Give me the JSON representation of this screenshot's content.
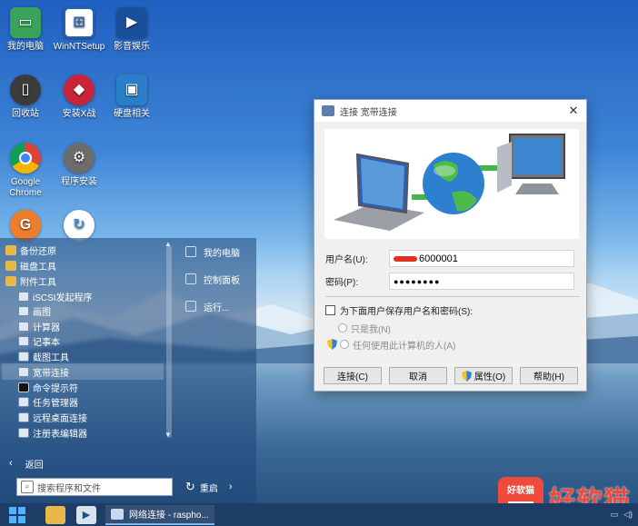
{
  "desktop": {
    "icons": [
      {
        "label": "我的电脑",
        "icon": "computer-icon",
        "color": "#3aa35a"
      },
      {
        "label": "WinNTSetup",
        "icon": "winntsetup-icon",
        "color": "#2a62b0"
      },
      {
        "label": "影音娱乐",
        "icon": "media-icon",
        "color": "#1a4f9a"
      },
      {
        "label": "回收站",
        "icon": "recycle-bin-icon",
        "color": "#3b3b3b"
      },
      {
        "label": "安装X战",
        "icon": "installer-icon",
        "color": "#c9243a"
      },
      {
        "label": "硬盘相关",
        "icon": "harddisk-icon",
        "color": "#2a7fc8"
      },
      {
        "label": "Google Chrome",
        "icon": "chrome-icon",
        "color": "#db4437"
      },
      {
        "label": "程序安装",
        "icon": "gear-icon",
        "color": "#6c6c6c"
      },
      {
        "label": "",
        "icon": "g-app-icon",
        "color": "#ef7d2a"
      },
      {
        "label": "",
        "icon": "refresh-app-icon",
        "color": "#ffffff"
      }
    ]
  },
  "start_menu": {
    "items": [
      {
        "label": "备份还原",
        "type": "folder"
      },
      {
        "label": "磁盘工具",
        "type": "folder"
      },
      {
        "label": "附件工具",
        "type": "folder"
      },
      {
        "label": "iSCSI发起程序",
        "type": "app"
      },
      {
        "label": "画图",
        "type": "app"
      },
      {
        "label": "计算器",
        "type": "app"
      },
      {
        "label": "记事本",
        "type": "app"
      },
      {
        "label": "截图工具",
        "type": "app"
      },
      {
        "label": "宽带连接",
        "type": "app"
      },
      {
        "label": "命令提示符",
        "type": "app"
      },
      {
        "label": "任务管理器",
        "type": "app"
      },
      {
        "label": "远程桌面连接",
        "type": "app"
      },
      {
        "label": "注册表编辑器",
        "type": "app"
      }
    ],
    "right_items": [
      {
        "label": "我的电脑"
      },
      {
        "label": "控制面板"
      },
      {
        "label": "运行..."
      }
    ],
    "back_label": "返回",
    "search_placeholder": "搜索程序和文件",
    "restart_label": "重启"
  },
  "taskbar": {
    "task_label": "网络连接 - raspho..."
  },
  "watermark": {
    "logo_text": "好软猫",
    "text": "好软猫"
  },
  "dialog": {
    "title": "连接 宽带连接",
    "username_label": "用户名(U):",
    "username_value": "6000001",
    "password_label": "密码(P):",
    "password_value": "●●●●●●●●",
    "save_label": "为下面用户保存用户名和密码(S):",
    "only_me_label": "只是我(N)",
    "anyone_label": "任何使用此计算机的人(A)",
    "buttons": {
      "connect": "连接(C)",
      "cancel": "取消",
      "properties": "属性(O)",
      "help": "帮助(H)"
    }
  }
}
